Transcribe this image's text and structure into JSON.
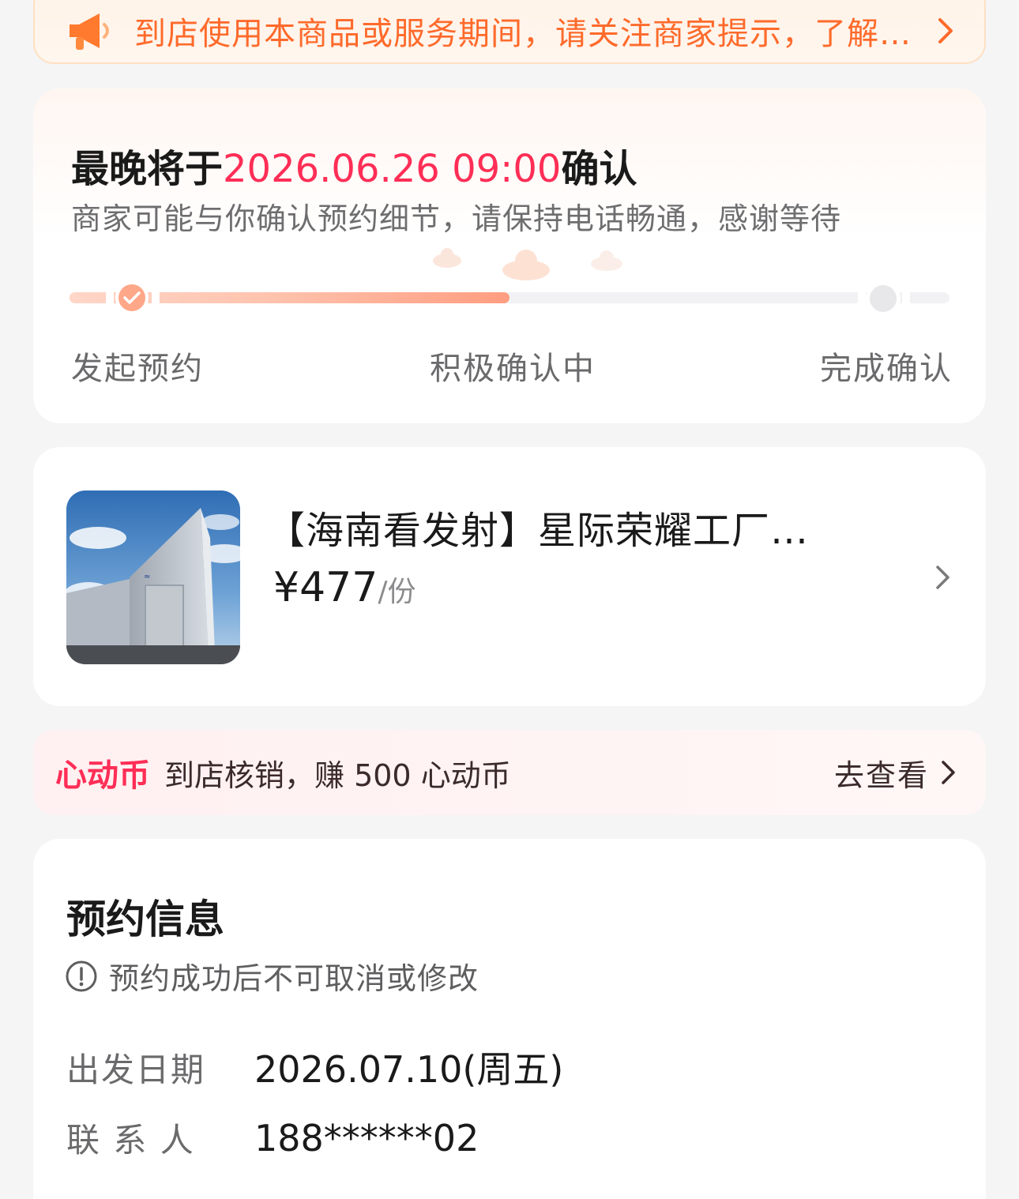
{
  "notice": {
    "icon": "megaphone-icon",
    "text": "到店使用本商品或服务期间，请关注商家提示，了解…"
  },
  "status": {
    "title_prefix": "最晚将于",
    "deadline": "2026.06.26 09:00",
    "title_suffix": "确认",
    "subtitle": "商家可能与你确认预约细节，请保持电话畅通，感谢等待",
    "progress_fraction": 0.5,
    "steps": [
      "发起预约",
      "积极确认中",
      "完成确认"
    ]
  },
  "product": {
    "name": "【海南看发射】星际荣耀工厂…",
    "price": "¥477",
    "unit": "/份"
  },
  "coin": {
    "brand": "心动币",
    "desc": "到店核销，赚 500 心动币",
    "action": "去查看"
  },
  "booking": {
    "title": "预约信息",
    "warning": "预约成功后不可取消或修改",
    "rows": [
      {
        "label": "出发日期",
        "value": "2026.07.10(周五)"
      },
      {
        "label": "联 系 人",
        "value": "188******02"
      }
    ]
  },
  "colors": {
    "accent_red": "#ff2e56",
    "notice_orange": "#ff6a2b",
    "progress_fill": "#ff9d80"
  }
}
